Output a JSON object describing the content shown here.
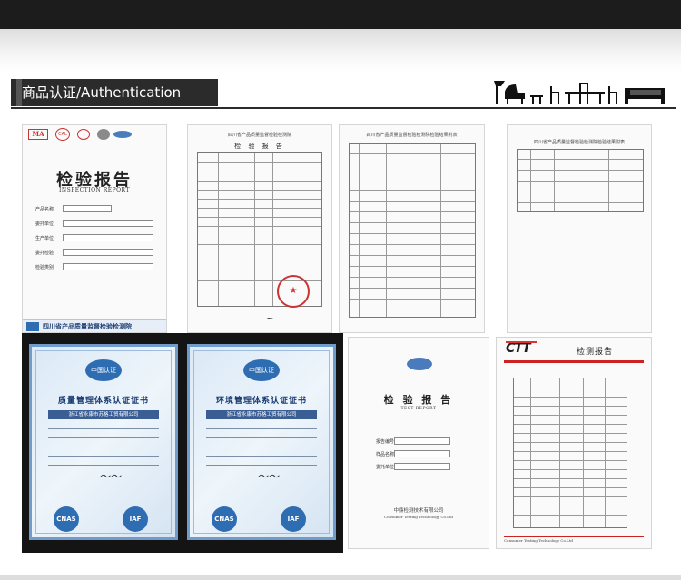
{
  "section": {
    "title": "商品认证/Authentication"
  },
  "certs": {
    "inspection_report": {
      "marks": [
        "MA",
        "CAL"
      ],
      "title_cn": "检验报告",
      "title_en": "INSPECTION REPORT",
      "footer": "四川省产品质量监督检验检测院"
    },
    "test_report_1": {
      "header": "四川省产品质量监督检验检测院",
      "title": "检 验 报 告"
    },
    "test_report_2": {
      "header": "四川省产品质量监督检验检测院检验结果附表"
    },
    "test_report_3": {
      "header": "四川省产品质量监督检验检测院检验结果附表"
    },
    "quality_cert": {
      "logo": "中国认证",
      "heading": "质量管理体系认证证书",
      "company": "浙江省永康市苏格工贸有限公司",
      "badges": [
        "CNAS",
        "IAF"
      ]
    },
    "env_cert": {
      "logo": "中国认证",
      "heading": "环境管理体系认证证书",
      "company": "浙江省永康市苏格工贸有限公司",
      "badges": [
        "CNAS",
        "IAF"
      ]
    },
    "test_report_4": {
      "title": "检 验 报 告",
      "subtitle": "TEST REPORT",
      "org": "中鼎检测技术有限公司",
      "org_en": "Consumer Testing Technology Co.Ltd"
    },
    "ctt_report": {
      "logo": "CTT",
      "title": "检测报告",
      "footer": "Consumer Testing Technology Co.Ltd"
    }
  }
}
